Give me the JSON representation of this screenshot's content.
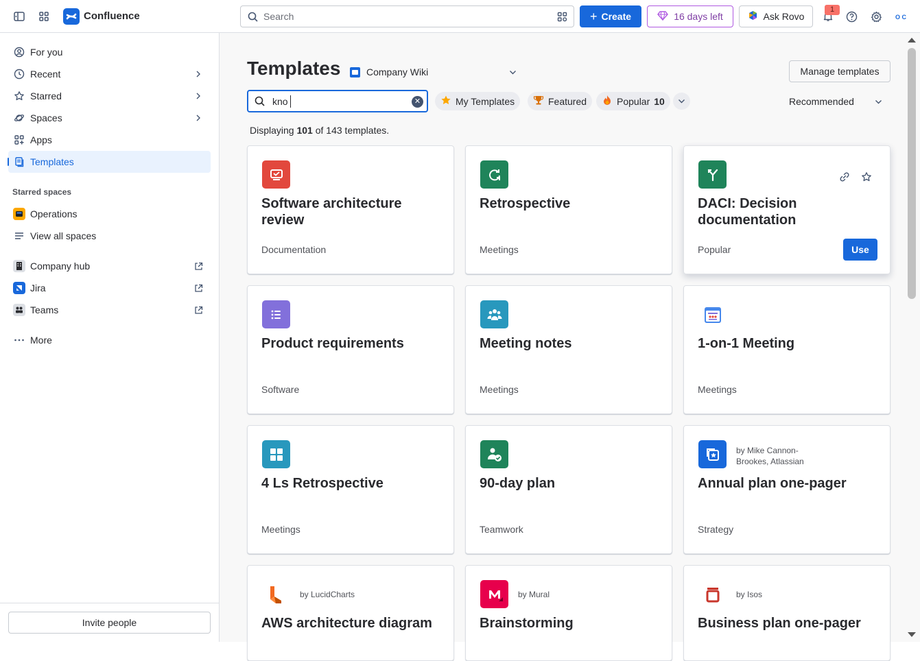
{
  "topbar": {
    "app_name": "Confluence",
    "search_placeholder": "Search",
    "create_label": "Create",
    "trial_label": "16 days left",
    "rovo_label": "Ask Rovo",
    "notification_count": "1",
    "avatar_initials": "O C"
  },
  "sidebar": {
    "items": [
      {
        "label": "For you",
        "icon": "user-circle-icon"
      },
      {
        "label": "Recent",
        "icon": "clock-icon"
      },
      {
        "label": "Starred",
        "icon": "star-icon"
      },
      {
        "label": "Spaces",
        "icon": "planet-icon"
      },
      {
        "label": "Apps",
        "icon": "apps-icon"
      },
      {
        "label": "Templates",
        "icon": "template-icon",
        "active": true
      }
    ],
    "starred_heading": "Starred spaces",
    "starred": [
      {
        "label": "Operations",
        "icon": "operations-space-icon"
      },
      {
        "label": "View all spaces",
        "icon": "list-icon"
      }
    ],
    "external": [
      {
        "label": "Company hub",
        "icon": "company-hub-icon"
      },
      {
        "label": "Jira",
        "icon": "jira-icon"
      },
      {
        "label": "Teams",
        "icon": "teams-icon"
      }
    ],
    "more_label": "More",
    "invite_label": "Invite people"
  },
  "main": {
    "title": "Templates",
    "space_name": "Company Wiki",
    "manage_label": "Manage templates",
    "search_value": "kno",
    "chips": [
      {
        "label": "My Templates"
      },
      {
        "label": "Featured"
      },
      {
        "label": "Popular",
        "count": "10"
      }
    ],
    "sort_label": "Recommended",
    "count_prefix": "Displaying",
    "count_shown": "101",
    "count_suffix": "of 143 templates.",
    "cards": [
      {
        "title": "Software architecture review",
        "category": "Documentation",
        "color": "#e2483d"
      },
      {
        "title": "Retrospective",
        "category": "Meetings",
        "color": "#1f845a"
      },
      {
        "title": "DACI: Decision documentation",
        "category": "Popular",
        "color": "#1f845a",
        "use_label": "Use"
      },
      {
        "title": "Product requirements",
        "category": "Software",
        "color": "#8270db"
      },
      {
        "title": "Meeting notes",
        "category": "Meetings",
        "color": "#2898bd"
      },
      {
        "title": "1-on-1 Meeting",
        "category": "Meetings",
        "color": "#4688ec"
      },
      {
        "title": "4 Ls Retrospective",
        "category": "Meetings",
        "color": "#2898bd"
      },
      {
        "title": "90-day plan",
        "category": "Teamwork",
        "color": "#1f845a"
      },
      {
        "title": "Annual plan one-pager",
        "category": "Strategy",
        "color": "#1868db",
        "by": "by Mike Cannon-Brookes, Atlassian"
      },
      {
        "title": "AWS architecture diagram",
        "color": "#f26a21",
        "by": "by LucidCharts"
      },
      {
        "title": "Brainstorming",
        "color": "#e7004c",
        "by": "by Mural"
      },
      {
        "title": "Business plan one-pager",
        "color": "#c9372c",
        "by": "by Isos"
      }
    ]
  }
}
